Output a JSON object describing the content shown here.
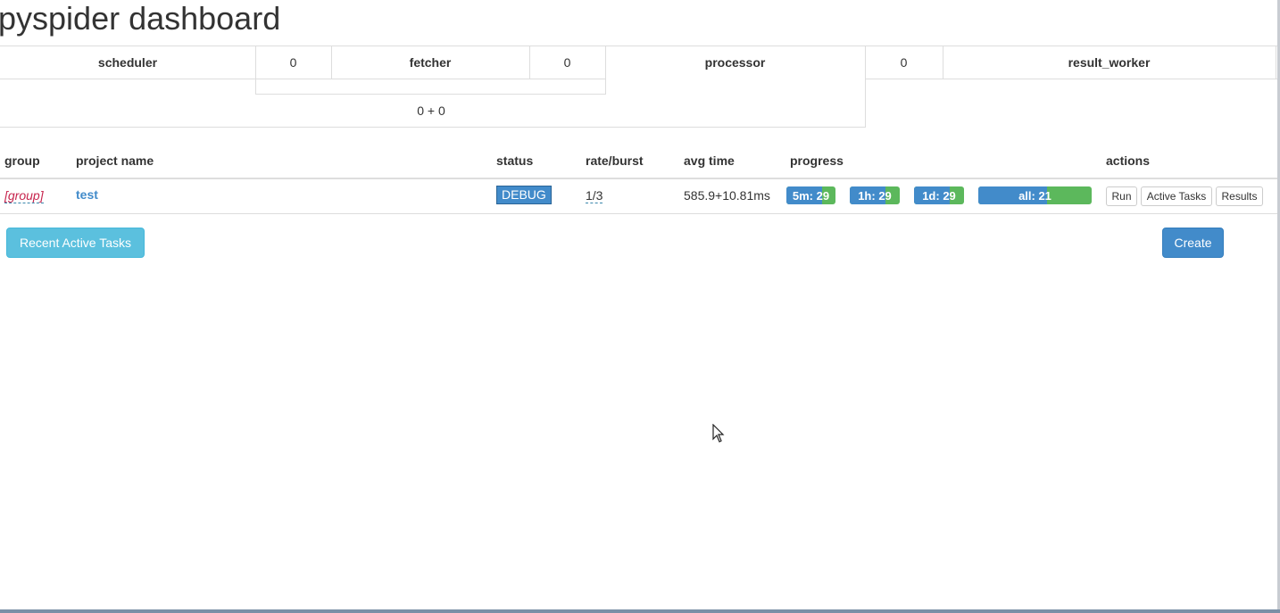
{
  "title": "pyspider dashboard",
  "queues": {
    "scheduler_label": "scheduler",
    "scheduler2fetcher": "0",
    "fetcher_label": "fetcher",
    "fetcher2processor": "0",
    "processor_label": "processor",
    "processor2result": "0",
    "result_worker_label": "result_worker",
    "new_tasks": "0 + 0"
  },
  "projects_table": {
    "headers": {
      "group": "group",
      "name": "project name",
      "status": "status",
      "rate": "rate/burst",
      "avg_time": "avg time",
      "progress": "progress",
      "actions": "actions"
    },
    "rows": [
      {
        "group": "[group]",
        "name": "test",
        "status": "DEBUG",
        "rate_burst": "1/3",
        "avg_time": "585.9+10.81ms",
        "progress": [
          {
            "label": "5m: 29",
            "pending_fraction": 0.72
          },
          {
            "label": "1h: 29",
            "pending_fraction": 0.72
          },
          {
            "label": "1d: 29",
            "pending_fraction": 0.72
          },
          {
            "label": "all: 21",
            "pending_fraction": 0.61
          }
        ],
        "actions": {
          "run": "Run",
          "active_tasks": "Active Tasks",
          "results": "Results"
        }
      }
    ]
  },
  "buttons": {
    "recent_active_tasks": "Recent Active Tasks",
    "create": "Create"
  },
  "colors": {
    "primary": "#428bca",
    "success": "#5cb85c",
    "info": "#5bc0de",
    "group_text": "#c7254e"
  }
}
